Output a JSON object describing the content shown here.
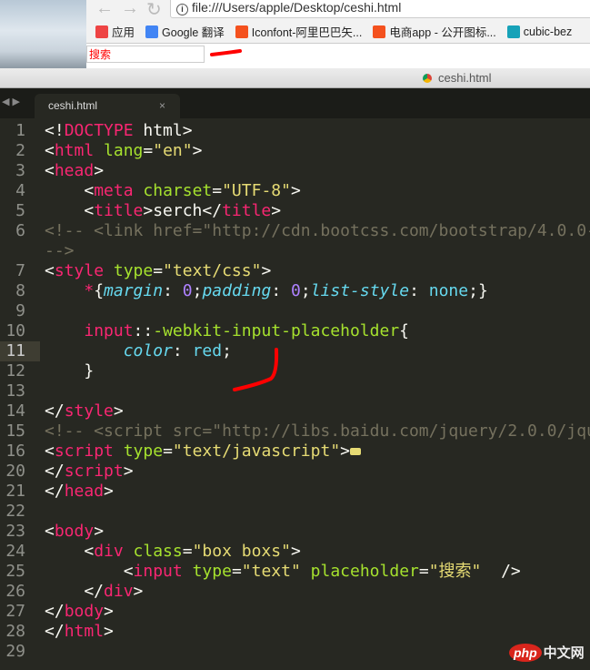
{
  "browser": {
    "url": "file:///Users/apple/Desktop/ceshi.html",
    "info_icon": "i",
    "bookmarks": [
      {
        "label": "应用",
        "icon": "apps-grid-icon",
        "color": "#e44"
      },
      {
        "label": "Google 翻译",
        "icon": "google-translate-icon",
        "color": "#4285f4"
      },
      {
        "label": "Iconfont-阿里巴巴矢...",
        "icon": "iconfont-icon",
        "color": "#f4511e"
      },
      {
        "label": "电商app - 公开图标...",
        "icon": "iconfont-icon",
        "color": "#f4511e"
      },
      {
        "label": "cubic-bez",
        "icon": "cubic-bezier-icon",
        "color": "#17a2b8"
      }
    ],
    "search_placeholder": "搜索"
  },
  "window": {
    "title": "ceshi.html"
  },
  "editor": {
    "tab": "ceshi.html",
    "close": "×",
    "arrows": "◀ ▶",
    "lines": [
      {
        "n": "1",
        "t": [
          [
            "txt",
            "<!"
          ],
          [
            "tag",
            "DOCTYPE"
          ],
          [
            "txt",
            " html>"
          ]
        ]
      },
      {
        "n": "2",
        "t": [
          [
            "txt",
            "<"
          ],
          [
            "tag",
            "html"
          ],
          [
            "txt",
            " "
          ],
          [
            "attr",
            "lang"
          ],
          [
            "txt",
            "="
          ],
          [
            "str",
            "\"en\""
          ],
          [
            "txt",
            ">"
          ]
        ]
      },
      {
        "n": "3",
        "t": [
          [
            "txt",
            "<"
          ],
          [
            "tag",
            "head"
          ],
          [
            "txt",
            ">"
          ]
        ]
      },
      {
        "n": "4",
        "t": [
          [
            "txt",
            "    <"
          ],
          [
            "tag",
            "meta"
          ],
          [
            "txt",
            " "
          ],
          [
            "attr",
            "charset"
          ],
          [
            "txt",
            "="
          ],
          [
            "str",
            "\"UTF-8\""
          ],
          [
            "txt",
            ">"
          ]
        ]
      },
      {
        "n": "5",
        "t": [
          [
            "txt",
            "    <"
          ],
          [
            "tag",
            "title"
          ],
          [
            "txt",
            ">serch</"
          ],
          [
            "tag",
            "title"
          ],
          [
            "txt",
            ">"
          ]
        ]
      },
      {
        "n": "6",
        "t": [
          [
            "cmt",
            "<!-- <link href=\"http://cdn.bootcss.com/bootstrap/4.0.0-"
          ]
        ]
      },
      {
        "n": "",
        "t": [
          [
            "cmt",
            "-->"
          ]
        ]
      },
      {
        "n": "7",
        "t": [
          [
            "txt",
            "<"
          ],
          [
            "tag",
            "style"
          ],
          [
            "txt",
            " "
          ],
          [
            "attr",
            "type"
          ],
          [
            "txt",
            "="
          ],
          [
            "str",
            "\"text/css\""
          ],
          [
            "txt",
            ">"
          ]
        ]
      },
      {
        "n": "8",
        "t": [
          [
            "txt",
            "    "
          ],
          [
            "tag",
            "*"
          ],
          [
            "txt",
            "{"
          ],
          [
            "prop",
            "margin"
          ],
          [
            "txt",
            ": "
          ],
          [
            "num",
            "0"
          ],
          [
            "txt",
            ";"
          ],
          [
            "prop",
            "padding"
          ],
          [
            "txt",
            ": "
          ],
          [
            "num",
            "0"
          ],
          [
            "txt",
            ";"
          ],
          [
            "prop",
            "list-style"
          ],
          [
            "txt",
            ": "
          ],
          [
            "kw",
            "none"
          ],
          [
            "txt",
            ";}"
          ]
        ]
      },
      {
        "n": "9",
        "t": []
      },
      {
        "n": "10",
        "t": [
          [
            "txt",
            "    "
          ],
          [
            "tag",
            "input"
          ],
          [
            "txt",
            "::"
          ],
          [
            "attr",
            "-webkit-input-placeholder"
          ],
          [
            "txt",
            "{"
          ]
        ]
      },
      {
        "n": "11",
        "cur": true,
        "t": [
          [
            "txt",
            "        "
          ],
          [
            "prop",
            "color"
          ],
          [
            "txt",
            ": "
          ],
          [
            "kw",
            "red"
          ],
          [
            "txt",
            ";"
          ]
        ]
      },
      {
        "n": "12",
        "t": [
          [
            "txt",
            "    }"
          ]
        ]
      },
      {
        "n": "13",
        "t": []
      },
      {
        "n": "14",
        "t": [
          [
            "txt",
            "</"
          ],
          [
            "tag",
            "style"
          ],
          [
            "txt",
            ">"
          ]
        ]
      },
      {
        "n": "15",
        "t": [
          [
            "cmt",
            "<!-- <script src=\"http://libs.baidu.com/jquery/2.0.0/jqu"
          ]
        ]
      },
      {
        "n": "16",
        "fold": true,
        "t": [
          [
            "txt",
            "<"
          ],
          [
            "tag",
            "script"
          ],
          [
            "txt",
            " "
          ],
          [
            "attr",
            "type"
          ],
          [
            "txt",
            "="
          ],
          [
            "str",
            "\"text/javascript\""
          ],
          [
            "txt",
            ">"
          ]
        ]
      },
      {
        "n": "20",
        "t": [
          [
            "txt",
            "</"
          ],
          [
            "tag",
            "script"
          ],
          [
            "txt",
            ">"
          ]
        ]
      },
      {
        "n": "21",
        "t": [
          [
            "txt",
            "</"
          ],
          [
            "tag",
            "head"
          ],
          [
            "txt",
            ">"
          ]
        ]
      },
      {
        "n": "22",
        "t": []
      },
      {
        "n": "23",
        "t": [
          [
            "txt",
            "<"
          ],
          [
            "tag",
            "body"
          ],
          [
            "txt",
            ">"
          ]
        ]
      },
      {
        "n": "24",
        "t": [
          [
            "txt",
            "    <"
          ],
          [
            "tag",
            "div"
          ],
          [
            "txt",
            " "
          ],
          [
            "attr",
            "class"
          ],
          [
            "txt",
            "="
          ],
          [
            "str",
            "\"box boxs\""
          ],
          [
            "txt",
            ">"
          ]
        ]
      },
      {
        "n": "25",
        "t": [
          [
            "txt",
            "        <"
          ],
          [
            "tag",
            "input"
          ],
          [
            "txt",
            " "
          ],
          [
            "attr",
            "type"
          ],
          [
            "txt",
            "="
          ],
          [
            "str",
            "\"text\""
          ],
          [
            "txt",
            " "
          ],
          [
            "attr",
            "placeholder"
          ],
          [
            "txt",
            "="
          ],
          [
            "str",
            "\"搜索\""
          ],
          [
            "txt",
            "  />"
          ]
        ]
      },
      {
        "n": "26",
        "t": [
          [
            "txt",
            "    </"
          ],
          [
            "tag",
            "div"
          ],
          [
            "txt",
            ">"
          ]
        ]
      },
      {
        "n": "27",
        "t": [
          [
            "txt",
            "</"
          ],
          [
            "tag",
            "body"
          ],
          [
            "txt",
            ">"
          ]
        ]
      },
      {
        "n": "28",
        "t": [
          [
            "txt",
            "</"
          ],
          [
            "tag",
            "html"
          ],
          [
            "txt",
            ">"
          ]
        ]
      },
      {
        "n": "29",
        "t": []
      }
    ]
  },
  "watermark": {
    "logo": "php",
    "text": "中文网"
  }
}
